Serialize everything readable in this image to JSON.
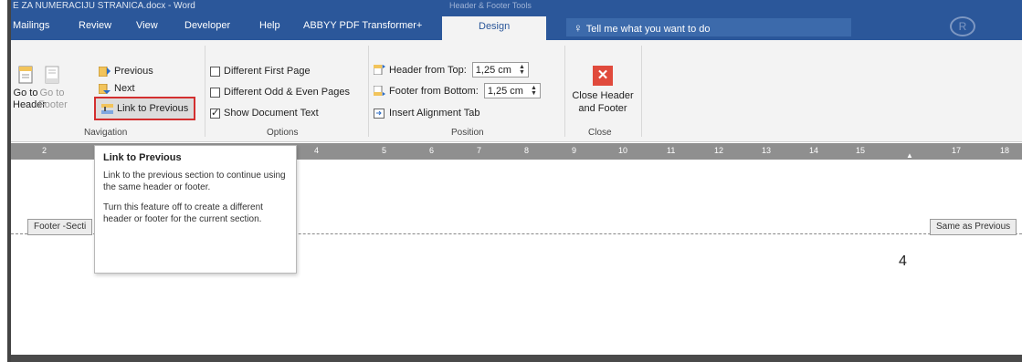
{
  "titlebar": {
    "document": "E ZA NUMERACIJU STRANICA.docx  -  Word",
    "context": "Header & Footer Tools"
  },
  "tabs": [
    "Mailings",
    "Review",
    "View",
    "Developer",
    "Help",
    "ABBYY PDF Transformer+",
    "Design"
  ],
  "active_tab": "Design",
  "tellme": "Tell me what you want to do",
  "navigation": {
    "goto_header": [
      "Go to",
      "Header"
    ],
    "goto_footer": [
      "Go to",
      "Footer"
    ],
    "previous": "Previous",
    "next": "Next",
    "link_to_previous": "Link to Previous",
    "label": "Navigation"
  },
  "options": {
    "different_first_page": "Different First Page",
    "different_odd_even": "Different Odd & Even Pages",
    "show_document_text": "Show Document Text",
    "label": "Options"
  },
  "position": {
    "header_from_top": "Header from Top:",
    "header_value": "1,25 cm",
    "footer_from_bottom": "Footer from Bottom:",
    "footer_value": "1,25 cm",
    "insert_alignment_tab": "Insert Alignment Tab",
    "label": "Position"
  },
  "close": {
    "button": [
      "Close Header",
      "and Footer"
    ],
    "label": "Close"
  },
  "ruler_ticks": [
    "2",
    "4",
    "5",
    "6",
    "7",
    "8",
    "9",
    "10",
    "11",
    "12",
    "13",
    "14",
    "15",
    "17",
    "18"
  ],
  "document": {
    "footer_section_tag": "Footer -Secti",
    "same_as_previous": "Same as Previous",
    "page_number": "4"
  },
  "tooltip": {
    "title": "Link to Previous",
    "line1": "Link to the previous section to continue using the same header or footer.",
    "line2": "Turn this feature off to create a different header or footer for the current section."
  },
  "colors": {
    "accent": "#2b579a",
    "close_red": "#e04a3c",
    "highlight_border": "#d32f2f"
  }
}
